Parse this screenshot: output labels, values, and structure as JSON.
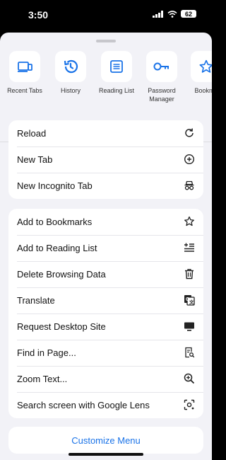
{
  "status_bar": {
    "time": "3:50",
    "battery": "62"
  },
  "carousel": [
    {
      "label": "Recent Tabs",
      "icon": "recent-tabs-icon"
    },
    {
      "label": "History",
      "icon": "history-icon"
    },
    {
      "label": "Reading List",
      "icon": "reading-list-icon"
    },
    {
      "label": "Password Manager",
      "icon": "key-icon"
    },
    {
      "label": "Bookma",
      "icon": "star-icon"
    }
  ],
  "group1": [
    {
      "label": "Reload",
      "icon": "reload-icon"
    },
    {
      "label": "New Tab",
      "icon": "plus-circle-icon"
    },
    {
      "label": "New Incognito Tab",
      "icon": "incognito-icon"
    }
  ],
  "group2": [
    {
      "label": "Add to Bookmarks",
      "icon": "star-outline-icon"
    },
    {
      "label": "Add to Reading List",
      "icon": "reading-list-add-icon"
    },
    {
      "label": "Delete Browsing Data",
      "icon": "trash-icon"
    },
    {
      "label": "Translate",
      "icon": "translate-icon"
    },
    {
      "label": "Request Desktop Site",
      "icon": "desktop-icon"
    },
    {
      "label": "Find in Page...",
      "icon": "find-in-page-icon"
    },
    {
      "label": "Zoom Text...",
      "icon": "zoom-icon"
    },
    {
      "label": "Search screen with Google Lens",
      "icon": "lens-icon"
    }
  ],
  "customize_label": "Customize Menu",
  "colors": {
    "accent": "#1a73e8",
    "sheet_bg": "#f2f2f7",
    "card_bg": "#ffffff"
  }
}
